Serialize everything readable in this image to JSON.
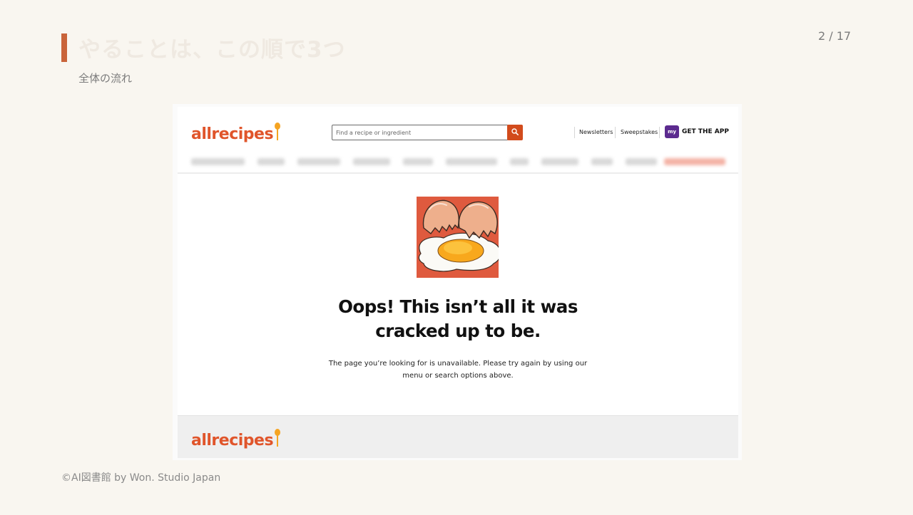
{
  "slide": {
    "title": "やることは、この順で3つ",
    "subtitle": "全体の流れ",
    "page_counter": "2 / 17",
    "footer_credit": "©AI図書館 by Won. Studio Japan"
  },
  "site": {
    "logo": "allrecipes",
    "search": {
      "placeholder": "Find a recipe or ingredient",
      "value": ""
    },
    "nav_links": [
      "Newsletters",
      "Sweepstakes"
    ],
    "app_badge": "my",
    "get_app_label": "GET THE APP",
    "footer_logo": "allrecipes"
  },
  "error_page": {
    "heading_line1": "Oops! This isn’t all it was",
    "heading_line2": "cracked up to be.",
    "message_line1": "The page you’re looking for is unavailable. Please try again by using our",
    "message_line2": "menu or search options above."
  },
  "colors": {
    "accent": "#c9643b",
    "brand_orange": "#e0552b",
    "search_button": "#d24b1c",
    "app_purple": "#5c2b8f"
  },
  "icons": [
    "search-icon",
    "spoon-icon",
    "broken-egg-illustration"
  ]
}
